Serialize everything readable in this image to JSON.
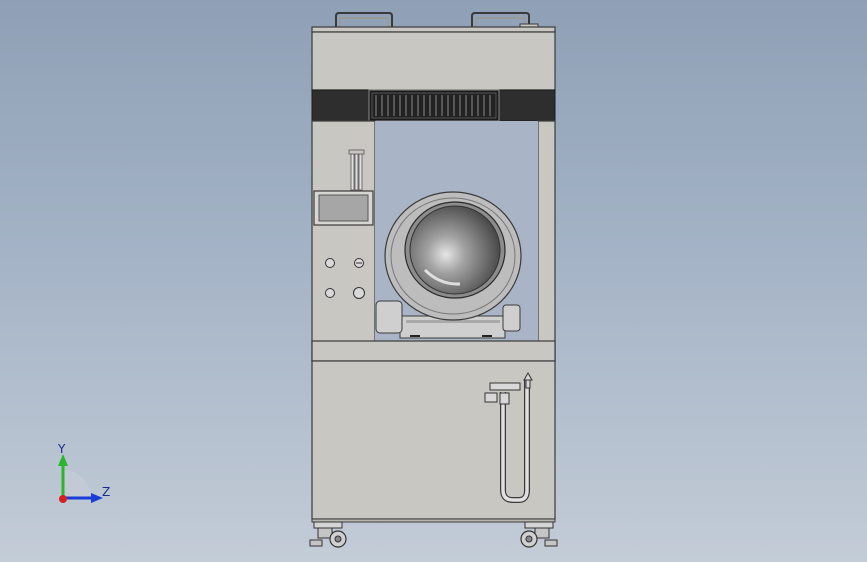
{
  "view": {
    "background_top": "#8fa0b6",
    "background_bottom": "#c3ccd7"
  },
  "model": {
    "body_color": "#c9c7c2",
    "outline_color": "#3a3a3a",
    "band_color": "#2e2e2e",
    "panel_color": "#d2d1cc",
    "drum_color": "#b8b8b8"
  },
  "triad": {
    "y_label": "Y",
    "z_label": "Z",
    "y_color": "#2bb52b",
    "z_color": "#1a3cd6",
    "x_color": "#d62020"
  }
}
